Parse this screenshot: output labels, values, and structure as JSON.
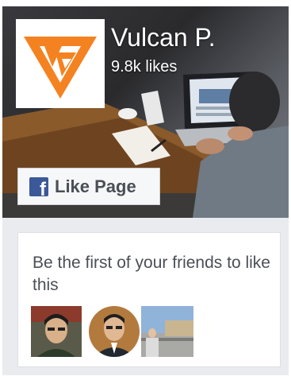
{
  "page": {
    "name": "Vulcan P.",
    "likes": "9.8k likes"
  },
  "like_button": {
    "icon_label": "f",
    "label": "Like Page"
  },
  "friends": {
    "text": "Be the first of your friends to like this",
    "avatars": [
      "friend-avatar-1",
      "friend-avatar-2",
      "friend-avatar-3"
    ]
  },
  "colors": {
    "brand_orange": "#f58220",
    "facebook_blue": "#3b5998",
    "button_text": "#4b4f56"
  }
}
